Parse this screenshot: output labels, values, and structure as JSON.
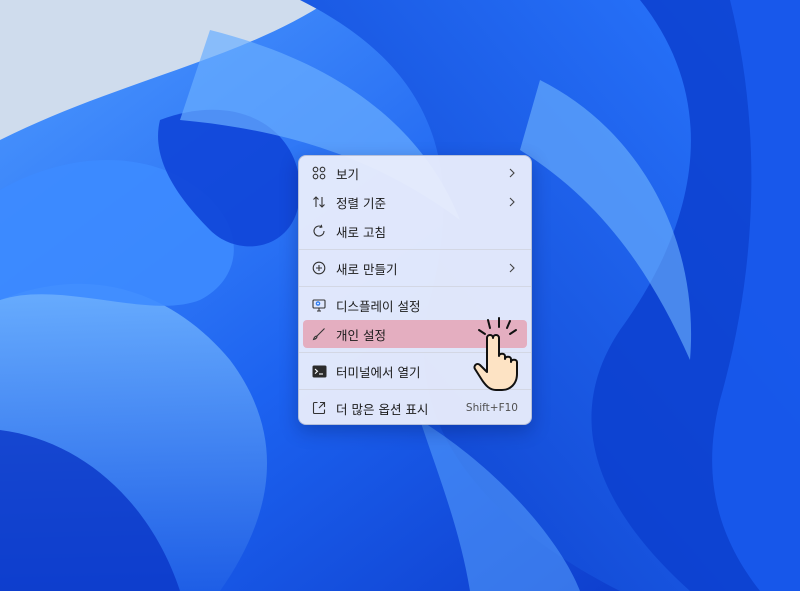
{
  "desktop": {
    "background_colors": [
      "#cfdced",
      "#0a3fd1",
      "#1e6cf5",
      "#5fa6ff"
    ]
  },
  "context_menu": {
    "items": [
      {
        "label": "보기",
        "icon": "grid-view-icon",
        "submenu": true
      },
      {
        "label": "정렬 기준",
        "icon": "sort-arrows-icon",
        "submenu": true
      },
      {
        "label": "새로 고침",
        "icon": "refresh-icon",
        "submenu": false
      },
      {
        "label": "새로 만들기",
        "icon": "plus-circle-icon",
        "submenu": true
      },
      {
        "label": "디스플레이 설정",
        "icon": "monitor-settings-icon",
        "submenu": false
      },
      {
        "label": "개인 설정",
        "icon": "brush-icon",
        "submenu": false,
        "highlighted": true
      },
      {
        "label": "터미널에서 열기",
        "icon": "terminal-icon",
        "submenu": false
      },
      {
        "label": "더 많은 옵션 표시",
        "icon": "expand-icon",
        "shortcut": "Shift+F10"
      }
    ],
    "highlight_color": "#e4aec0"
  },
  "cursor": {
    "icon": "pointing-hand-cursor-icon"
  }
}
